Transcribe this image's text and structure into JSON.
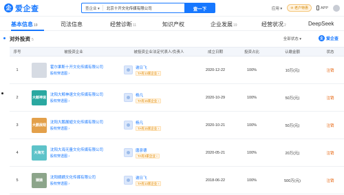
{
  "header": {
    "logo_mark": "企",
    "logo_text": "爱企查",
    "search_type": "查企业 ▾",
    "search_value": "北京十开文化传媒有限公司",
    "search_button": "查一下",
    "menu_app": "应用 ▾",
    "vip": "♔ 老户特惠",
    "app_download": "APP"
  },
  "tabs": [
    {
      "label": "基本信息",
      "count": "19"
    },
    {
      "label": "司法信息",
      "count": ""
    },
    {
      "label": "经营诊断",
      "count": "11"
    },
    {
      "label": "知识产权",
      "count": ""
    },
    {
      "label": "企业发展",
      "count": "19"
    },
    {
      "label": "经营状况",
      "count": "2"
    },
    {
      "label": "DeepSeek",
      "count": ""
    }
  ],
  "section": {
    "title": "对外投资",
    "count": "5",
    "filter": "全部状态 ▾",
    "export_mark": "企",
    "export_label": "爱企查"
  },
  "table": {
    "headers": [
      "序号",
      "被投资企业",
      "被投资企业法定代表人/负责人",
      "成立日期",
      "投资占比",
      "认缴金额",
      "状态"
    ],
    "rows": [
      {
        "idx": "1",
        "logo": "",
        "logo_color": "#d6dbe3",
        "company": "霍尔果斯十开文化传媒有限公司",
        "sub": "股权穿透图 ›",
        "rep": "谢日飞",
        "rep_tag": "TA有13家企业 ›",
        "date": "2020-12-22",
        "pct": "100%",
        "capital": "10万(元)",
        "status": "注销"
      },
      {
        "idx": "2",
        "logo": "大鲸神速",
        "logo_color": "#2aa8a0",
        "company": "沈阳大鲸神速文化传媒有限公司",
        "sub": "股权穿透图 ›",
        "rep": "杨凡",
        "rep_tag": "TA有15家企业 ›",
        "date": "2020-10-29",
        "pct": "100%",
        "capital": "50万(元)",
        "status": "注销"
      },
      {
        "idx": "3",
        "logo": "大鹏展翅",
        "logo_color": "#e3a04a",
        "company": "沈阳大鹏展翅文化传媒有限公司",
        "sub": "股权穿透图 ›",
        "rep": "杨凡",
        "rep_tag": "TA有15家企业 ›",
        "date": "2020-10-21",
        "pct": "100%",
        "capital": "50万(元)",
        "status": "注销"
      },
      {
        "idx": "4",
        "logo": "大海无",
        "logo_color": "#5ec3c9",
        "company": "沈阳大海无量文化传媒有限公司",
        "sub": "股权穿透图 ›",
        "rep": "唐彦德",
        "rep_tag": "TA有3家企业 ›",
        "date": "2020-05-21",
        "pct": "100%",
        "capital": "20万(元)",
        "status": "注销"
      },
      {
        "idx": "5",
        "logo": "嫡嫡",
        "logo_color": "#8ca58a",
        "company": "沈阳嫡嫡文化传媒有限公司",
        "sub": "股权穿透图 ›",
        "rep": "谢日飞",
        "rep_tag": "TA有13家企业 ›",
        "date": "2018-06-22",
        "pct": "100%",
        "capital": "500万(元)",
        "status": "注销"
      }
    ]
  }
}
